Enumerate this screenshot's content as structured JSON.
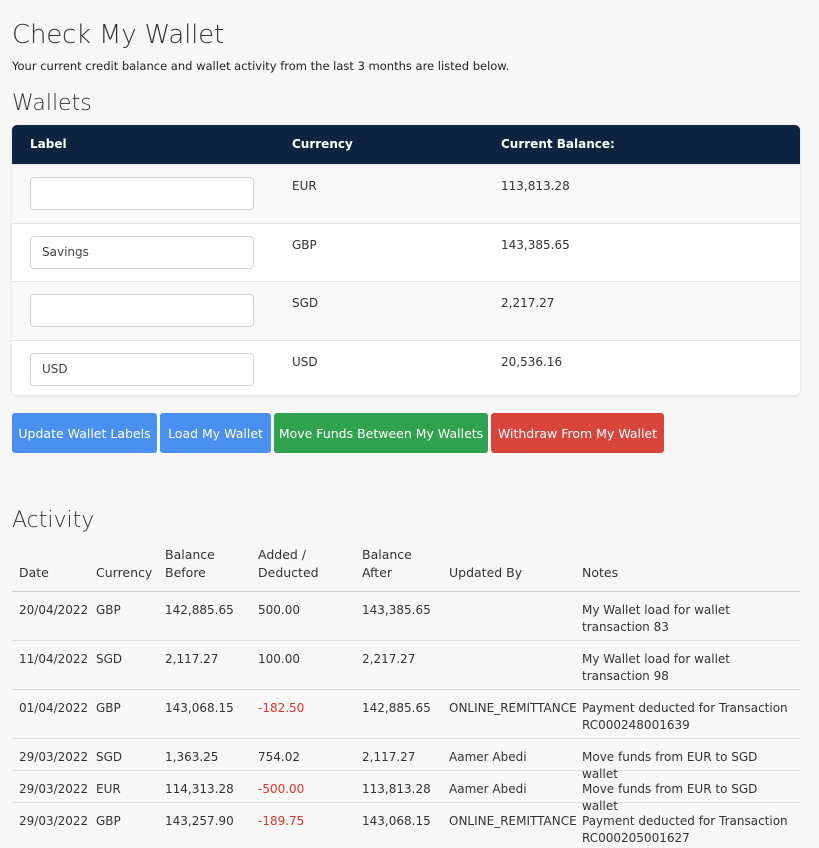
{
  "page": {
    "title": "Check My Wallet",
    "subtitle": "Your current credit balance and wallet activity from the last 3 months are listed below."
  },
  "wallets": {
    "title": "Wallets",
    "headers": {
      "label": "Label",
      "currency": "Currency",
      "balance": "Current Balance:"
    },
    "rows": [
      {
        "label_value": "",
        "currency": "EUR",
        "balance": "113,813.28"
      },
      {
        "label_value": "Savings",
        "currency": "GBP",
        "balance": "143,385.65"
      },
      {
        "label_value": "",
        "currency": "SGD",
        "balance": "2,217.27"
      },
      {
        "label_value": "USD",
        "currency": "USD",
        "balance": "20,536.16"
      }
    ]
  },
  "buttons": {
    "update_labels": "Update Wallet Labels",
    "load_wallet": "Load My Wallet",
    "move_funds": "Move Funds Between My Wallets",
    "withdraw": "Withdraw From My Wallet"
  },
  "activity": {
    "title": "Activity",
    "headers": {
      "date": "Date",
      "currency": "Currency",
      "balance_before_1": "Balance",
      "balance_before_2": "Before",
      "added_1": "Added /",
      "added_2": "Deducted",
      "balance_after_1": "Balance",
      "balance_after_2": "After",
      "updated_by": "Updated By",
      "notes": "Notes"
    },
    "rows": [
      {
        "date": "20/04/2022",
        "currency": "GBP",
        "before": "142,885.65",
        "added": "500.00",
        "after": "143,385.65",
        "by": "",
        "notes": "My Wallet load for wallet transaction 83"
      },
      {
        "date": "11/04/2022",
        "currency": "SGD",
        "before": "2,117.27",
        "added": "100.00",
        "after": "2,217.27",
        "by": "",
        "notes": "My Wallet load for wallet transaction 98"
      },
      {
        "date": "01/04/2022",
        "currency": "GBP",
        "before": "143,068.15",
        "added": "-182.50",
        "after": "142,885.65",
        "by": "ONLINE_REMITTANCE",
        "notes": "Payment deducted for Transaction RC000248001639"
      },
      {
        "date": "29/03/2022",
        "currency": "SGD",
        "before": "1,363.25",
        "added": "754.02",
        "after": "2,117.27",
        "by": "Aamer Abedi",
        "notes": "Move funds from EUR to SGD wallet"
      },
      {
        "date": "29/03/2022",
        "currency": "EUR",
        "before": "114,313.28",
        "added": "-500.00",
        "after": "113,813.28",
        "by": "Aamer Abedi",
        "notes": "Move funds from EUR to SGD wallet"
      },
      {
        "date": "29/03/2022",
        "currency": "GBP",
        "before": "143,257.90",
        "added": "-189.75",
        "after": "143,068.15",
        "by": "ONLINE_REMITTANCE",
        "notes": "Payment deducted for Transaction RC000205001627"
      }
    ]
  },
  "colors": {
    "header_navy": "#0f2441",
    "button_blue": "#4a90f0",
    "button_green": "#2fa14f",
    "button_red": "#d8453b",
    "negative_red": "#e0342b"
  }
}
